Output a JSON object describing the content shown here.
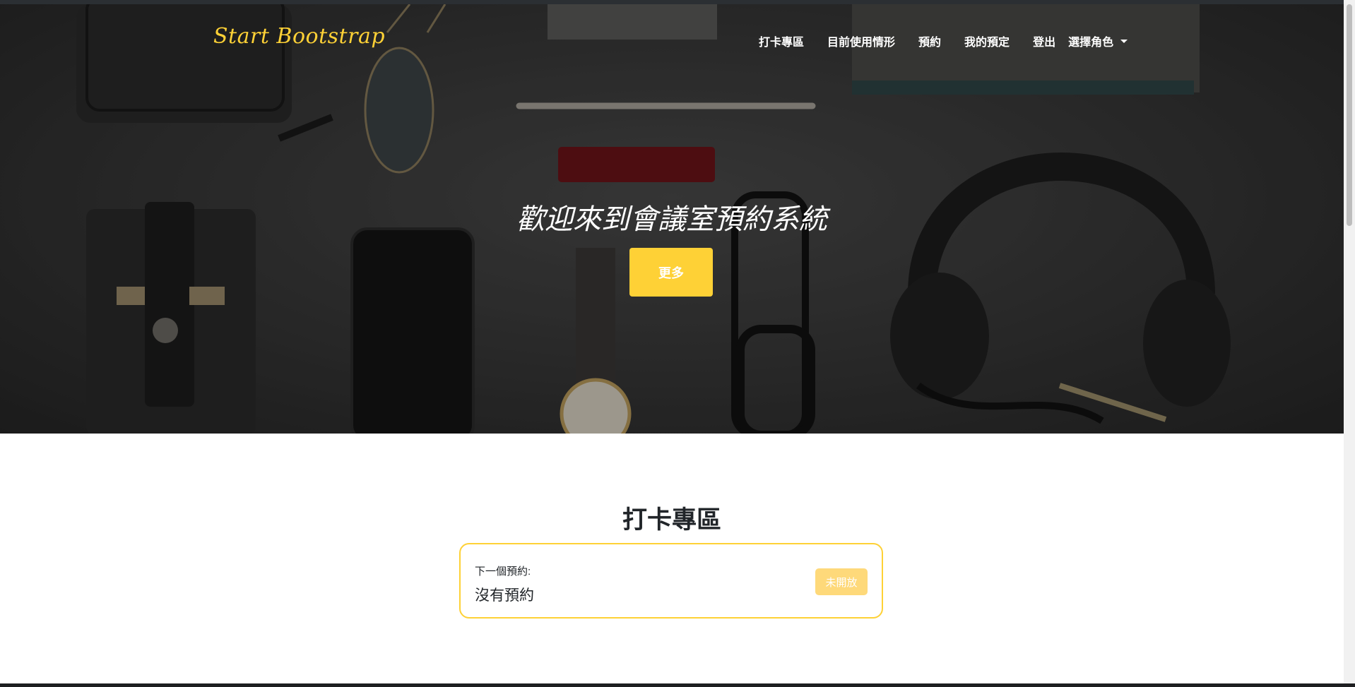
{
  "navbar": {
    "brand": "Start Bootstrap",
    "items": [
      {
        "label": "打卡專區"
      },
      {
        "label": "目前使用情形"
      },
      {
        "label": "預約"
      },
      {
        "label": "我的預定"
      },
      {
        "label": "登出"
      }
    ],
    "role_dropdown": {
      "label": "選擇角色",
      "icon": "caret-down-icon"
    }
  },
  "hero": {
    "title": "歡迎來到會議室預約系統",
    "button_label": "更多"
  },
  "checkin": {
    "section_title": "打卡專區",
    "card": {
      "label": "下一個預約:",
      "value": "沒有預約",
      "button_label": "未開放"
    }
  },
  "colors": {
    "accent": "#fed136",
    "accent_disabled": "#fed97a",
    "text": "#212529"
  }
}
